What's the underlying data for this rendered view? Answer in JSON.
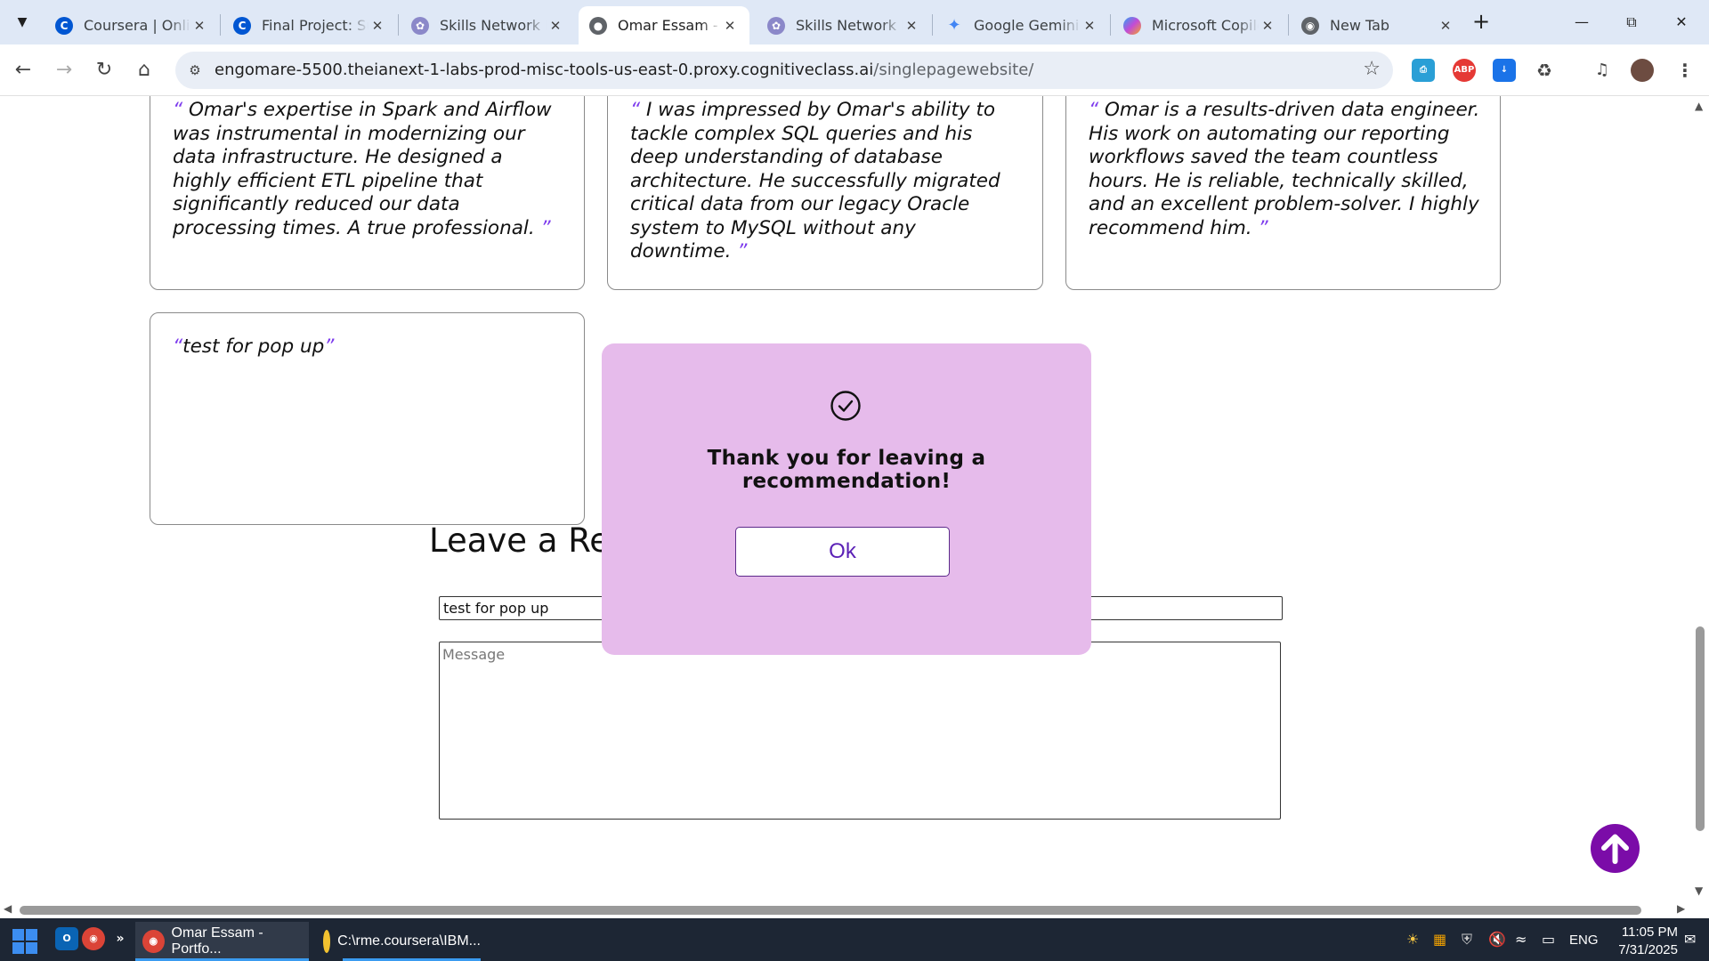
{
  "browser": {
    "tabs": [
      {
        "label": "Coursera | Online Courses",
        "icon": "coursera-icon",
        "active": false
      },
      {
        "label": "Final Project: Submit",
        "icon": "coursera-icon",
        "active": false
      },
      {
        "label": "Skills Network Labs",
        "icon": "skills-network-icon",
        "active": false
      },
      {
        "label": "Omar Essam - Portfolio",
        "icon": "globe-icon",
        "active": true
      },
      {
        "label": "Skills Network Editor",
        "icon": "skills-network-icon",
        "active": false
      },
      {
        "label": "Google Gemini",
        "icon": "gemini-icon",
        "active": false
      },
      {
        "label": "Microsoft Copilot",
        "icon": "copilot-icon",
        "active": false
      },
      {
        "label": "New Tab",
        "icon": "chrome-icon",
        "active": false
      }
    ],
    "url_host": "engomare-5500.theianext-1-labs-prod-misc-tools-us-east-0.proxy.cognitiveclass.ai",
    "url_path": "/singlepagewebsite/"
  },
  "page": {
    "recommendations": [
      {
        "text": "Omar's expertise in Spark and Airflow was instrumental in modernizing our data infrastructure. He designed a highly efficient ETL pipeline that significantly reduced our data processing times. A true professional."
      },
      {
        "text": "I was impressed by Omar's ability to tackle complex SQL queries and his deep understanding of database architecture. He successfully migrated critical data from our legacy Oracle system to MySQL without any downtime."
      },
      {
        "text": "Omar is a results-driven data engineer. His work on automating our reporting workflows saved the team countless hours. He is reliable, technically skilled, and an excellent problem-solver. I highly recommend him."
      },
      {
        "text": "test for pop up"
      }
    ],
    "quote_open": "“",
    "quote_close": "”",
    "section_title": "Leave a Recommendation",
    "name_value": "test for pop up",
    "message_placeholder": "Message"
  },
  "popup": {
    "message": "Thank you for leaving a recommendation!",
    "ok_label": "Ok",
    "background": "#e6bbeb"
  },
  "colors": {
    "accent": "#7b0ca8",
    "quote_mark": "#7c3aed"
  },
  "taskbar": {
    "apps": [
      {
        "label": "Omar Essam - Portfo...",
        "icon": "chrome-icon",
        "active": true
      },
      {
        "label": "C:\\rme.coursera\\IBM...",
        "icon": "folder-icon",
        "active": false
      }
    ],
    "language": "ENG",
    "time": "11:05 PM",
    "date": "7/31/2025"
  }
}
